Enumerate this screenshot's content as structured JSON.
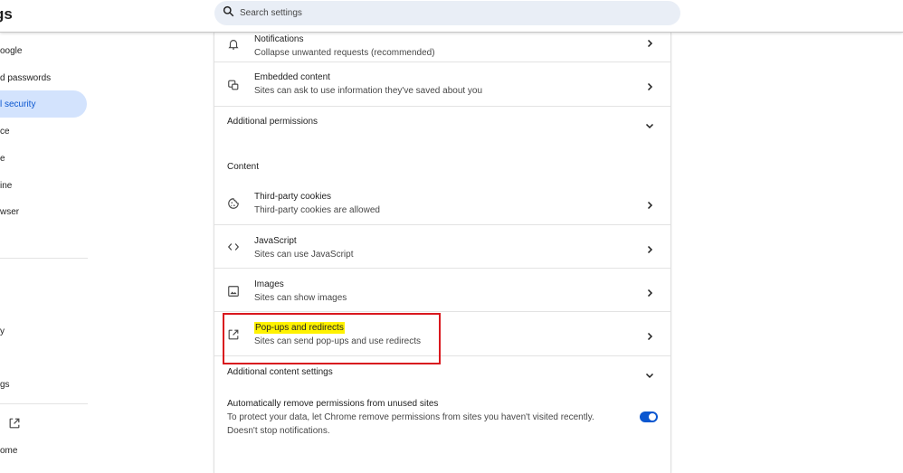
{
  "header": {
    "title": "gs",
    "search_placeholder": "Search settings"
  },
  "sidebar": {
    "items": [
      {
        "label": "oogle"
      },
      {
        "label": "d passwords"
      },
      {
        "label": "l security"
      },
      {
        "label": "ce"
      },
      {
        "label": "e"
      },
      {
        "label": "ine"
      },
      {
        "label": "wser"
      },
      {
        "label": "y"
      },
      {
        "label": "gs"
      },
      {
        "label": "ome"
      }
    ]
  },
  "permissions": {
    "notifications": {
      "title": "Notifications",
      "subtitle": "Collapse unwanted requests (recommended)"
    },
    "embedded": {
      "title": "Embedded content",
      "subtitle": "Sites can ask to use information they've saved about you"
    },
    "additional_permissions": "Additional permissions"
  },
  "content": {
    "heading": "Content",
    "cookies": {
      "title": "Third-party cookies",
      "subtitle": "Third-party cookies are allowed"
    },
    "javascript": {
      "title": "JavaScript",
      "subtitle": "Sites can use JavaScript"
    },
    "images": {
      "title": "Images",
      "subtitle": "Sites can show images"
    },
    "popups": {
      "title": "Pop-ups and redirects",
      "subtitle": "Sites can send pop-ups and use redirects"
    },
    "additional_content": "Additional content settings"
  },
  "auto_remove": {
    "title": "Automatically remove permissions from unused sites",
    "description": "To protect your data, let Chrome remove permissions from sites you haven't visited recently. Doesn't stop notifications.",
    "enabled": true
  },
  "colors": {
    "accent": "#0b57d0",
    "active_nav_bg": "#d3e3fd",
    "highlight": "#fff200",
    "annotation_red": "#d9181e"
  }
}
